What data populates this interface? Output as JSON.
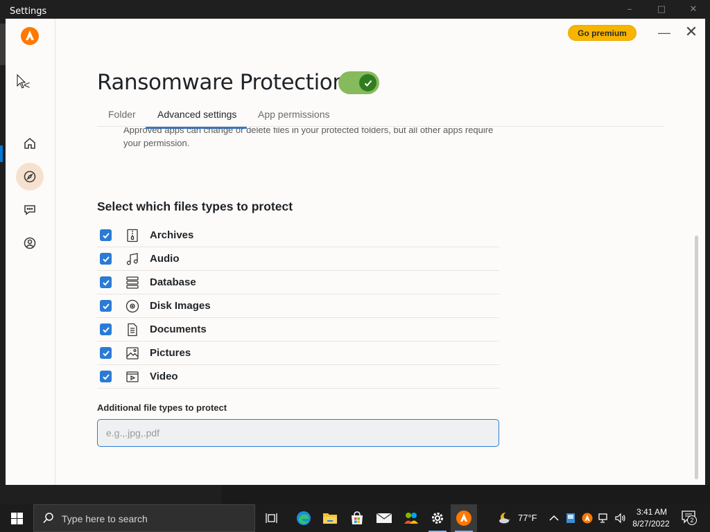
{
  "outer_window": {
    "title": "Settings",
    "controls": [
      "–",
      "□",
      "✕"
    ]
  },
  "app": {
    "go_premium_label": "Go premium",
    "minimize_glyph": "—",
    "close_glyph": "✕",
    "back_glyph": "<",
    "brand_color": "#ff7800",
    "accent_color": "#2a7bd6",
    "nav_items": [
      {
        "name": "home",
        "icon": "home-icon"
      },
      {
        "name": "explore",
        "icon": "compass-icon",
        "active": true
      },
      {
        "name": "chat",
        "icon": "chat-icon"
      },
      {
        "name": "account",
        "icon": "account-icon"
      }
    ]
  },
  "page": {
    "title": "Ransomware Protection",
    "toggle_on": true,
    "tabs": [
      {
        "label": "Folder",
        "active": false
      },
      {
        "label": "Advanced settings",
        "active": true
      },
      {
        "label": "App permissions",
        "active": false
      }
    ],
    "description": "Approved apps can change or delete files in your protected folders, but all other apps require your permission.",
    "section_heading": "Select which files types to protect",
    "file_types": [
      {
        "label": "Archives",
        "icon": "archive-icon",
        "checked": true
      },
      {
        "label": "Audio",
        "icon": "music-icon",
        "checked": true
      },
      {
        "label": "Database",
        "icon": "database-icon",
        "checked": true
      },
      {
        "label": "Disk Images",
        "icon": "disc-icon",
        "checked": true
      },
      {
        "label": "Documents",
        "icon": "document-icon",
        "checked": true
      },
      {
        "label": "Pictures",
        "icon": "picture-icon",
        "checked": true
      },
      {
        "label": "Video",
        "icon": "video-icon",
        "checked": true
      }
    ],
    "additional_label": "Additional file types to protect",
    "additional_placeholder": "e.g.,.jpg,.pdf",
    "additional_value": ""
  },
  "taskbar": {
    "search_placeholder": "Type here to search",
    "pinned_apps": [
      "task-view-icon",
      "edge-icon",
      "file-explorer-icon",
      "store-icon",
      "mail-icon",
      "people-icon",
      "settings-icon",
      "avast-icon"
    ],
    "weather_temp": "77°F",
    "clock_time": "3:41 AM",
    "clock_date": "8/27/2022",
    "notification_count": "2"
  }
}
